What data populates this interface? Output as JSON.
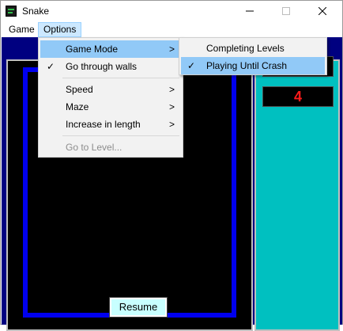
{
  "window": {
    "title": "Snake",
    "icon": "snake-app-icon"
  },
  "controls": {
    "minimize_icon": "minimize-icon",
    "maximize_icon": "maximize-icon",
    "close_icon": "close-icon"
  },
  "menubar": {
    "items": [
      {
        "label": "Game"
      },
      {
        "label": "Options"
      }
    ]
  },
  "options_menu": {
    "items": [
      {
        "label": "Game Mode",
        "has_submenu": true,
        "checked": false,
        "highlighted": true
      },
      {
        "label": "Go through walls",
        "has_submenu": false,
        "checked": true
      },
      {
        "label": "Speed",
        "has_submenu": true
      },
      {
        "label": "Maze",
        "has_submenu": true
      },
      {
        "label": "Increase in length",
        "has_submenu": true
      },
      {
        "label": "Go to Level...",
        "disabled": true
      }
    ],
    "submenu_arrow": ">",
    "check_glyph": "✓"
  },
  "game_mode_submenu": {
    "items": [
      {
        "label": "Completing Levels",
        "checked": false
      },
      {
        "label": "Playing Until Crash",
        "checked": true
      }
    ]
  },
  "score_panel": {
    "bottom_value": "4"
  },
  "resume_button": {
    "label": "Resume"
  },
  "colors": {
    "client_background": "#000080",
    "playfield": "#000000",
    "wall": "#0000ee",
    "score_panel": "#00c0c0",
    "score_text": "#ff1a1a",
    "menu_highlight": "#91c9f7",
    "resume_button": "#c8ffff"
  }
}
